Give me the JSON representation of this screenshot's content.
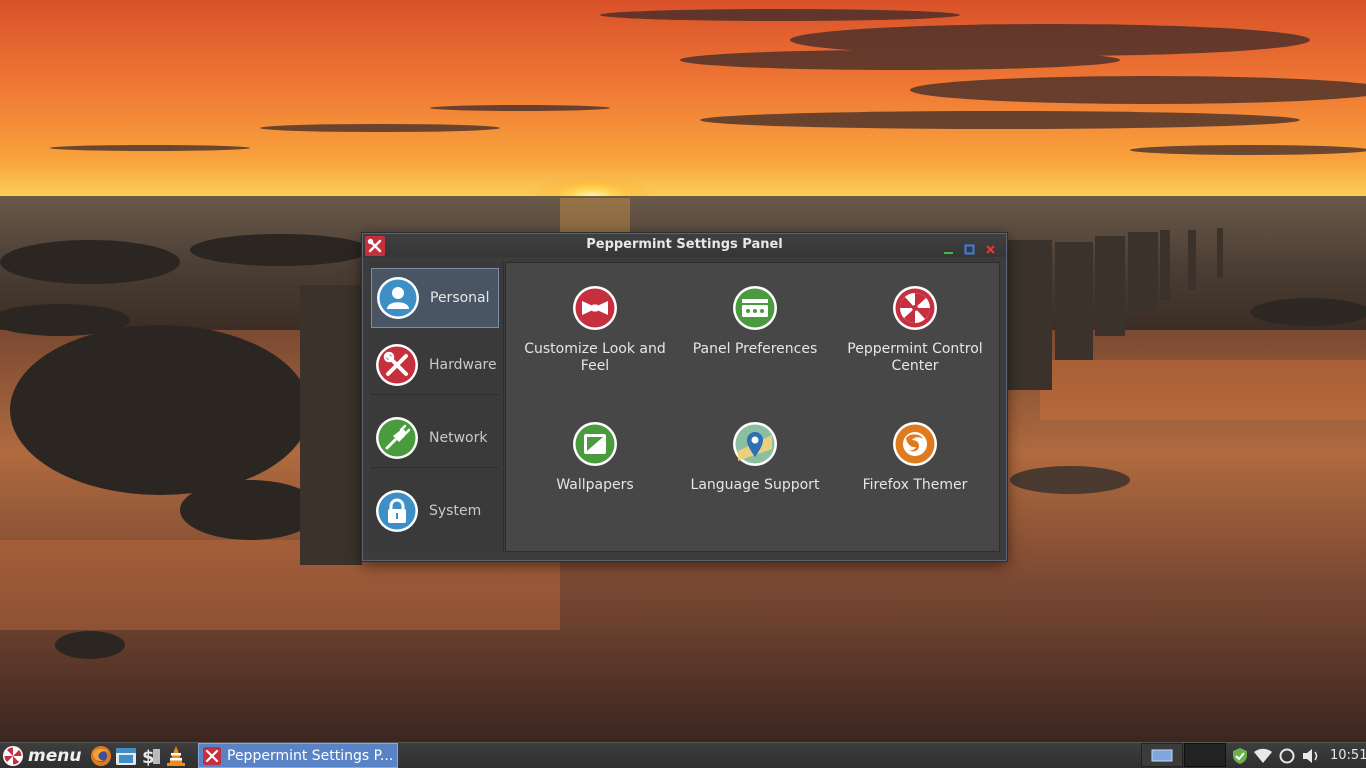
{
  "window": {
    "title": "Peppermint Settings Panel",
    "categories": [
      {
        "label": "Personal",
        "icon": "person-icon",
        "color": "#3d8fc6",
        "active": true
      },
      {
        "label": "Hardware",
        "icon": "tools-icon",
        "color": "#c62f3e",
        "active": false
      },
      {
        "label": "Network",
        "icon": "plug-icon",
        "color": "#4a9b3e",
        "active": false
      },
      {
        "label": "System",
        "icon": "lock-icon",
        "color": "#3d8fc6",
        "active": false
      }
    ],
    "tools": [
      {
        "label": "Customize Look and Feel",
        "icon": "bowtie-icon",
        "color": "#c62f3e"
      },
      {
        "label": "Panel Preferences",
        "icon": "panel-icon",
        "color": "#4a9b3e"
      },
      {
        "label": "Peppermint Control Center",
        "icon": "peppermint-icon",
        "color": "#c62f3e"
      },
      {
        "label": "Wallpapers",
        "icon": "wallpaper-icon",
        "color": "#4a9b3e"
      },
      {
        "label": "Language Support",
        "icon": "map-pin-icon",
        "color": "#8bbf9f"
      },
      {
        "label": "Firefox Themer",
        "icon": "firefox-icon",
        "color": "#e07a1f"
      }
    ]
  },
  "taskbar": {
    "menu_label": "menu",
    "task_label": "Peppermint Settings P...",
    "clock": "10:51",
    "launchers": [
      "firefox-icon",
      "file-manager-icon",
      "terminal-icon",
      "vlc-icon"
    ]
  },
  "colors": {
    "accent": "#5a83c7",
    "window_bg": "#3c3c3c",
    "main_bg": "#474747",
    "min_button": "#3dbb3d",
    "max_button": "#3d7fe0",
    "close_button": "#e03b3b"
  }
}
